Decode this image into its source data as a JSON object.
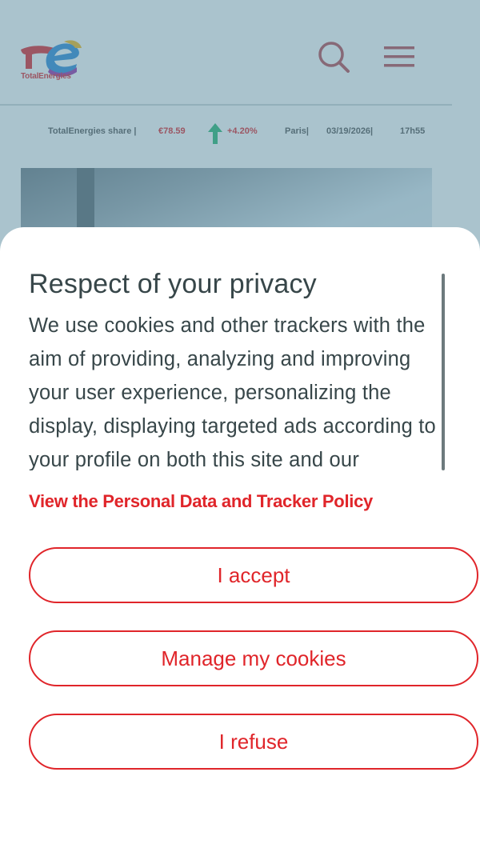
{
  "site": {
    "logo_text": "TotalEnergies",
    "ticker": {
      "label": "TotalEnergies share  |",
      "price": "€78.59",
      "change": "+4.20%",
      "place": "Paris|",
      "date": "03/19/2026|",
      "time": "17h55"
    },
    "icons": {
      "search": "search-icon",
      "menu": "hamburger-menu-icon",
      "trend": "arrow-up-icon"
    }
  },
  "cookie_modal": {
    "title": "Respect of your privacy",
    "body": "We use cookies and other trackers with the aim of providing, analyzing and improving your user experience, personalizing the display, displaying targeted ads according to your profile on both this site and our",
    "policy_link": "View the Personal Data and Tracker Policy",
    "buttons": {
      "accept": "I accept",
      "manage": "Manage my cookies",
      "refuse": "I refuse"
    }
  },
  "colors": {
    "brand_red": "#e0252a",
    "text_dark": "#374649",
    "overlay": "#55879b",
    "trend_green": "#2bb673"
  }
}
